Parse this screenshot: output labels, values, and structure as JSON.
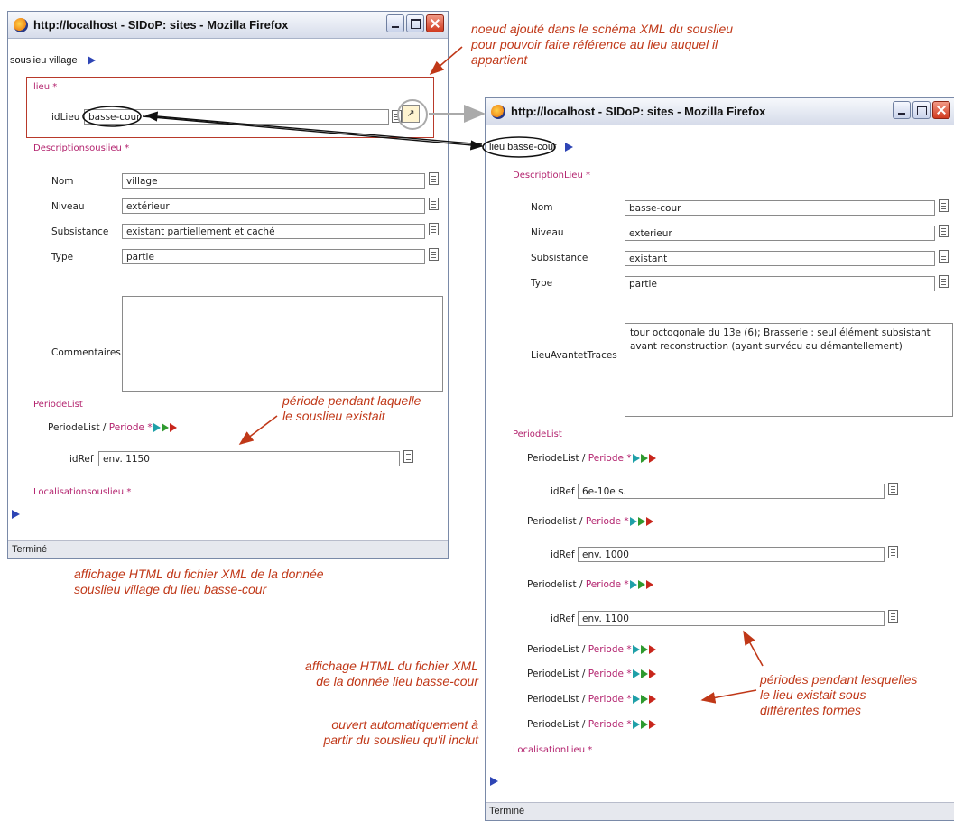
{
  "window_title": "http://localhost - SIDoP: sites - Mozilla Firefox",
  "status_text": "Terminé",
  "left_window": {
    "breadcrumb": "souslieu village",
    "lieu_section": "lieu",
    "id_lieu_label": "idLieu",
    "id_lieu_value": "basse-cour",
    "description_section": "Descriptionsouslieu",
    "fields": [
      {
        "label": "Nom",
        "value": "village"
      },
      {
        "label": "Niveau",
        "value": "extérieur"
      },
      {
        "label": "Subsistance",
        "value": "existant partiellement et caché"
      },
      {
        "label": "Type",
        "value": "partie"
      }
    ],
    "commentaires_label": "Commentaires",
    "commentaires_value": "",
    "periode_list_title": "PeriodeList",
    "periode_prefix": "PeriodeList /",
    "periode_name": "Periode",
    "idref_label": "idRef",
    "idref_value": "env. 1150",
    "localisation_section": "Localisationsouslieu"
  },
  "right_window": {
    "breadcrumb": "lieu basse-cour",
    "description_section": "DescriptionLieu",
    "fields": [
      {
        "label": "Nom",
        "value": "basse-cour"
      },
      {
        "label": "Niveau",
        "value": "exterieur"
      },
      {
        "label": "Subsistance",
        "value": "existant"
      },
      {
        "label": "Type",
        "value": "partie"
      }
    ],
    "lieu_avant_label": "LieuAvantetTraces",
    "lieu_avant_value": "tour octogonale du 13e (6); Brasserie : seul élément subsistant avant reconstruction (ayant survécu au démantellement)",
    "periode_list_title": "PeriodeList",
    "periode_rows": [
      {
        "prefix": "PeriodeList /",
        "idref": "6e-10e s."
      },
      {
        "prefix": "Periodelist /",
        "idref": "env. 1000"
      },
      {
        "prefix": "Periodelist /",
        "idref": "env. 1100"
      },
      {
        "prefix": "PeriodeList /"
      },
      {
        "prefix": "PeriodeList /"
      },
      {
        "prefix": "PeriodeList /"
      },
      {
        "prefix": "PeriodeList /"
      }
    ],
    "periode_name": "Periode",
    "idref_label": "idRef",
    "localisation_section": "LocalisationLieu"
  },
  "annotations": {
    "top_note": [
      "noeud ajouté dans le schéma XML du souslieu",
      "pour pouvoir faire référence au lieu auquel il",
      "appartient"
    ],
    "periode_note": [
      "période pendant laquelle",
      "le souslieu existait"
    ],
    "left_caption": [
      "affichage HTML du fichier XML de la donnée",
      "souslieu village du lieu basse-cour"
    ],
    "middle_caption": [
      "affichage HTML du fichier XML",
      "de la donnée lieu basse-cour"
    ],
    "middle_caption2": [
      "ouvert automatiquement à",
      "partir du souslieu qu'il inclut"
    ],
    "right_note": [
      "périodes pendant lesquelles",
      "le lieu existait sous",
      "différentes formes"
    ]
  },
  "colors": {
    "annotation": "#c03818",
    "section_label": "#b3236e",
    "nav_triangle": "#2e45b5"
  },
  "icons": [
    "firefox-icon",
    "minimize-icon",
    "maximize-icon",
    "close-icon",
    "document-icon",
    "link-lookup-icon",
    "play-triangle-icon"
  ]
}
